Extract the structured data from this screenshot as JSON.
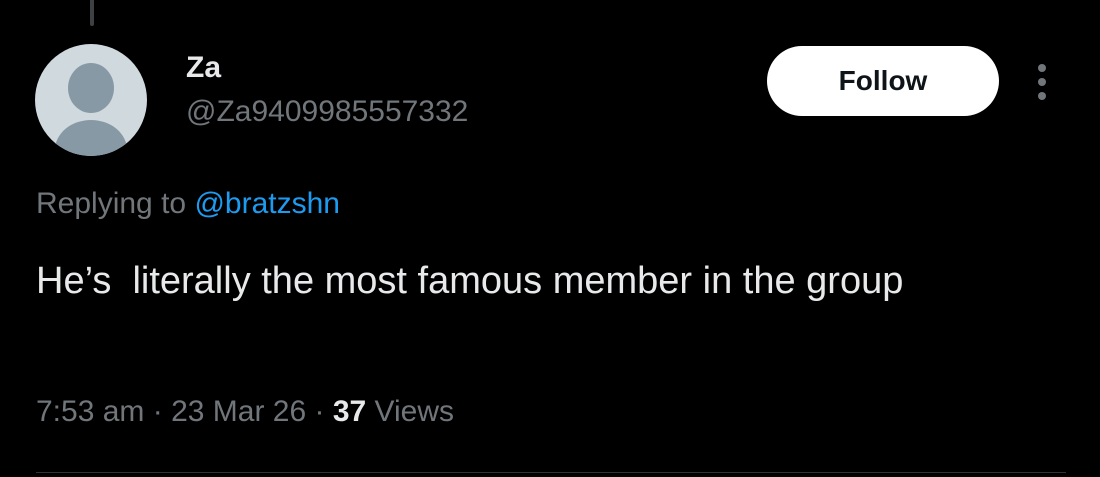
{
  "tweet": {
    "author": {
      "display_name": "Za",
      "handle": "@Za9409985557332"
    },
    "follow_label": "Follow",
    "replying_prefix": "Replying to ",
    "replying_to": "@bratzshn",
    "text": "He’s  literally the most famous member in the group",
    "time": "7:53 am",
    "separator": " · ",
    "date": "23 Mar 26",
    "views_count": "37",
    "views_label": " Views"
  },
  "icons": {
    "more": "more-vertical-icon",
    "avatar": "default-avatar-icon"
  },
  "colors": {
    "background": "#000000",
    "primary_text": "#e7e9ea",
    "secondary_text": "#71767b",
    "link": "#1d9bf0",
    "follow_button_bg": "#ffffff",
    "follow_button_text": "#0f1419"
  }
}
